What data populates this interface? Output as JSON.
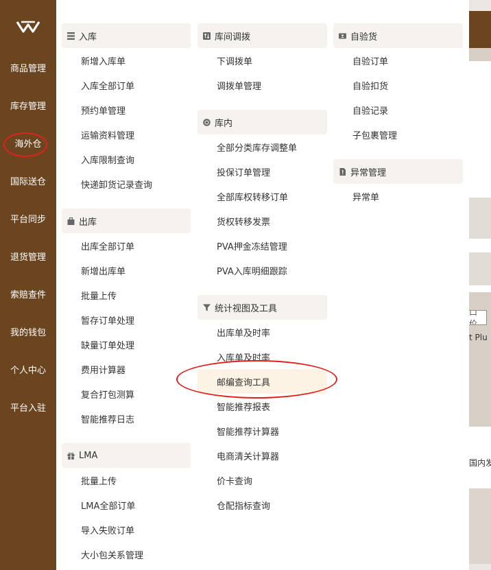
{
  "sidebar": {
    "logo_icon": "w-logo-icon",
    "items": [
      {
        "label": "商品管理"
      },
      {
        "label": "库存管理"
      },
      {
        "label": "海外仓"
      },
      {
        "label": "国际送仓"
      },
      {
        "label": "平台同步"
      },
      {
        "label": "退货管理"
      },
      {
        "label": "索赔查件"
      },
      {
        "label": "我的钱包"
      },
      {
        "label": "个人中心"
      },
      {
        "label": "平台入驻"
      }
    ],
    "active": "海外仓"
  },
  "menu": {
    "col1": [
      {
        "header": "入库",
        "icon": "list-icon",
        "items": [
          "新增入库单",
          "入库全部订单",
          "预约单管理",
          "运输资料管理",
          "入库限制查询",
          "快递卸货记录查询"
        ]
      },
      {
        "header": "出库",
        "icon": "bag-icon",
        "items": [
          "出库全部订单",
          "新增出库单",
          "批量上传",
          "暂存订单处理",
          "缺量订单处理",
          "费用计算器",
          "复合打包测算",
          "智能推荐日志"
        ]
      },
      {
        "header": "LMA",
        "icon": "gift-icon",
        "items": [
          "批量上传",
          "LMA全部订单",
          "导入失败订单",
          "大小包关系管理"
        ]
      }
    ],
    "col2": [
      {
        "header": "库间调拨",
        "icon": "transfer-icon",
        "items": [
          "下调拨单",
          "调拨单管理"
        ]
      },
      {
        "header": "库内",
        "icon": "box-icon",
        "items": [
          "全部分类库存调整单",
          "投保订单管理",
          "全部库权转移订单",
          "货权转移发票",
          "PVA押金冻结管理",
          "PVA入库明细跟踪"
        ]
      },
      {
        "header": "统计视图及工具",
        "icon": "filter-icon",
        "items": [
          "出库单及时率",
          "入库单及时率",
          "邮编查询工具",
          "智能推荐报表",
          "智能推荐计算器",
          "电商清关计算器",
          "价卡查询",
          "仓配指标查询"
        ]
      }
    ],
    "col3": [
      {
        "header": "自验货",
        "icon": "id-card-icon",
        "items": [
          "自验订单",
          "自验扣货",
          "自验记录",
          "子包裹管理"
        ]
      },
      {
        "header": "异常管理",
        "icon": "doc-alert-icon",
        "items": [
          "异常单"
        ]
      }
    ],
    "highlighted_item": "邮编查询工具"
  },
  "background": {
    "frag1": "口价",
    "frag2": "t Plu",
    "frag3": "国内发"
  },
  "colors": {
    "sidebar": "#6b4520",
    "section_header": "#f6f2ee",
    "highlight": "#fdf3e4",
    "annotation_ring": "#e0201a"
  }
}
